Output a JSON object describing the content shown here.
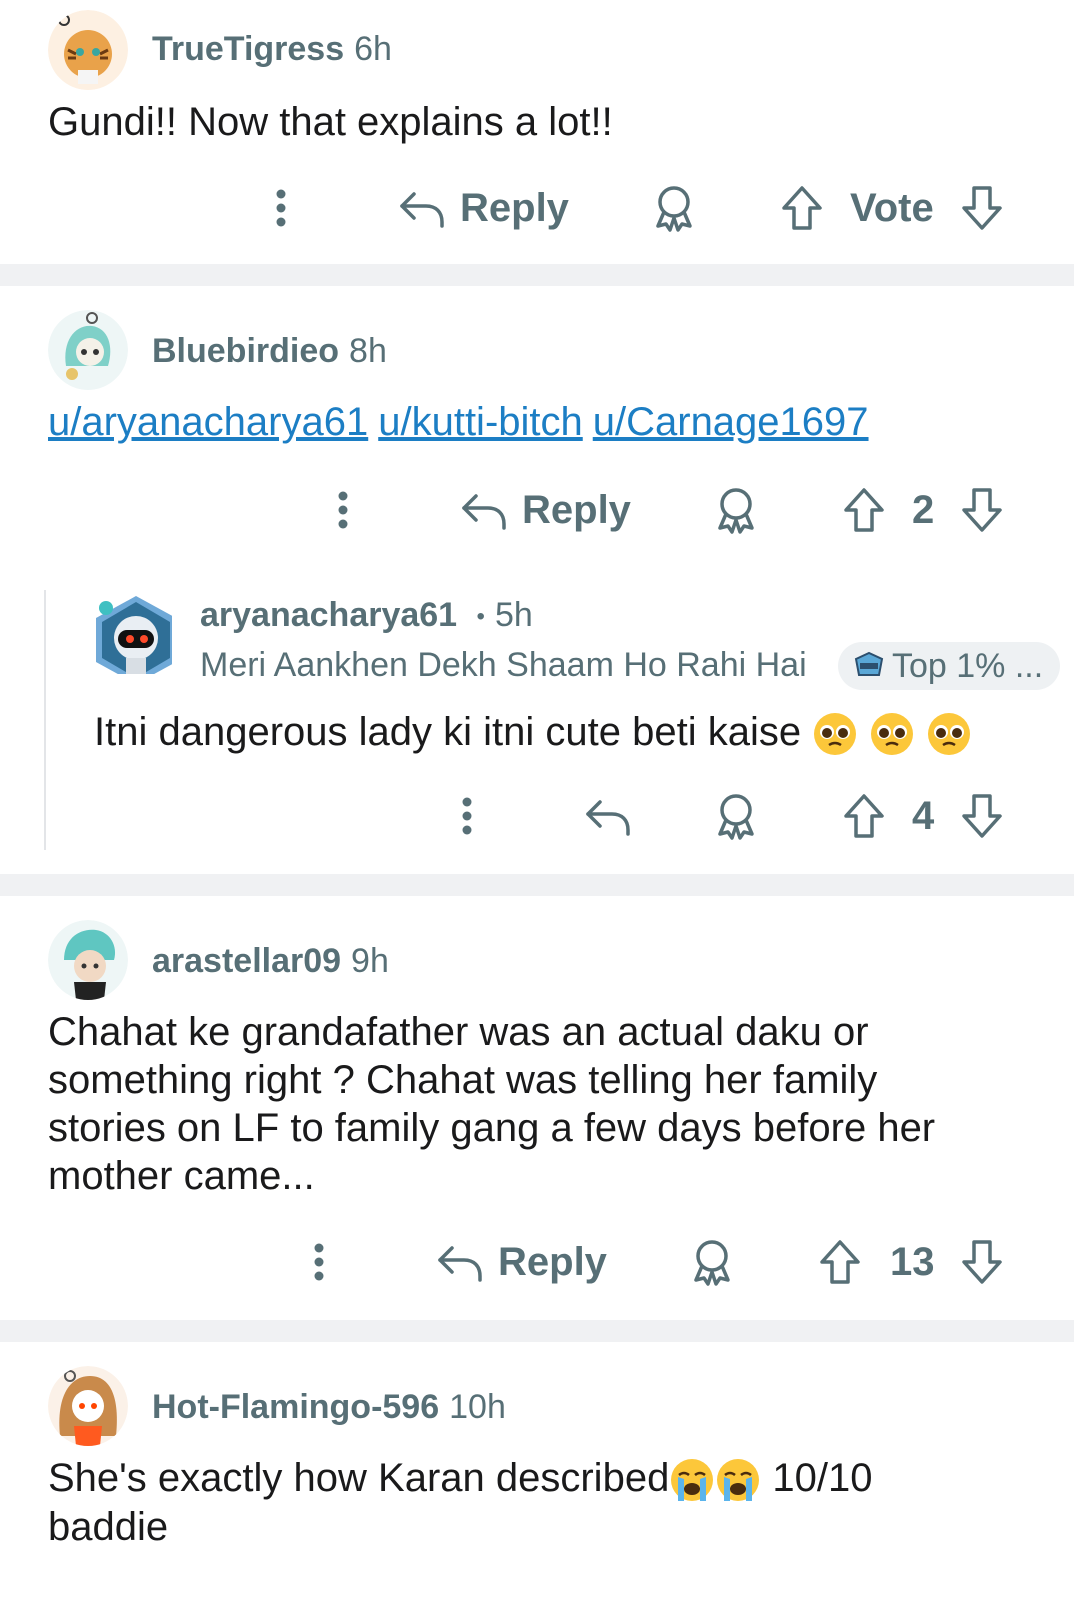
{
  "comments": [
    {
      "user": "TrueTigress",
      "time": "6h",
      "text": "Gundi!! Now that explains a lot!!",
      "reply_label": "Reply",
      "vote_label": "Vote"
    },
    {
      "user": "Bluebirdieo",
      "time": "8h",
      "mentions": [
        "u/aryanacharya61",
        "u/kutti-bitch",
        "u/Carnage1697"
      ],
      "reply_label": "Reply",
      "score": "2"
    },
    {
      "user": "arastellar09",
      "time": "9h",
      "text": "Chahat ke grandafather was an actual daku or something right ? Chahat was telling her family stories on LF to family gang a few days before her mother came...",
      "reply_label": "Reply",
      "score": "13"
    },
    {
      "user": "Hot-Flamingo-596",
      "time": "10h",
      "text_before": "She's exactly how Karan described",
      "text_after": " 10/10 baddie"
    }
  ],
  "reply": {
    "user": "aryanacharya61",
    "separator": "•",
    "time": "5h",
    "flair": "Meri Aankhen Dekh Shaam Ho Rahi Hai",
    "badge": "Top 1% ...",
    "text": "Itni dangerous lady ki itni cute beti kaise",
    "score": "4"
  },
  "colors": {
    "meta": "#576f76",
    "link": "#1c7ec4",
    "divider": "#f0f1f3"
  },
  "icons": [
    "overflow-menu-icon",
    "reply-arrow-icon",
    "award-icon",
    "upvote-icon",
    "downvote-icon",
    "pleading-face-emoji",
    "crying-face-emoji",
    "top-contributor-icon"
  ]
}
